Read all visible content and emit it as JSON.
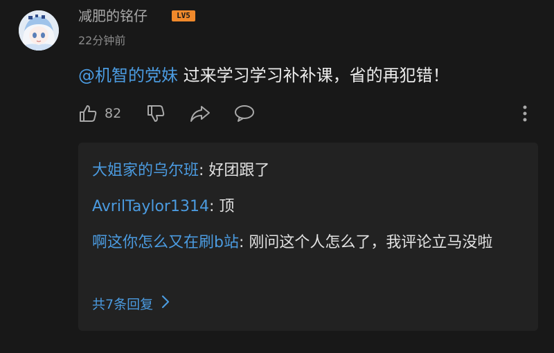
{
  "comment": {
    "username": "减肥的铭仔",
    "level": "LV5",
    "timestamp": "22分钟前",
    "mention": "@机智的党妹",
    "text": " 过来学习学习补补课，省的再犯错！",
    "likes": "82"
  },
  "icons": {
    "like": "thumbs-up-icon",
    "dislike": "thumbs-down-icon",
    "share": "share-icon",
    "reply": "comment-bubble-icon",
    "more": "more-vertical-icon",
    "expand": "chevron-right-icon"
  },
  "replies": {
    "items": [
      {
        "author": "大姐家的乌尔班",
        "separator": ": ",
        "text": "好团跟了"
      },
      {
        "author": "AvrilTaylor1314",
        "separator": ": ",
        "text": "顶"
      },
      {
        "author": "啊这你怎么又在刷b站",
        "separator": ": ",
        "text": "刚问这个人怎么了，我评论立马没啦"
      }
    ],
    "more_label": "共7条回复"
  },
  "colors": {
    "background": "#181818",
    "reply_panel": "#222222",
    "link": "#4b9be0",
    "level_badge": "#f0892b"
  }
}
